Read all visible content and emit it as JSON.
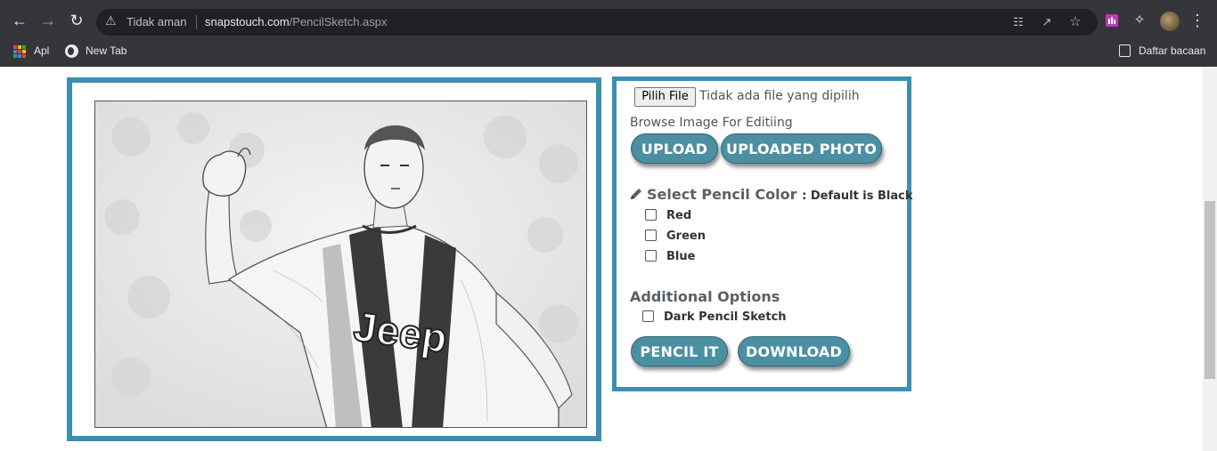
{
  "browser": {
    "security_label": "Tidak aman",
    "url_host": "snapstouch.com",
    "url_path": "/PencilSketch.aspx",
    "bookmarks": [
      {
        "label": "Apl"
      },
      {
        "label": "New Tab"
      }
    ],
    "reading_list_label": "Daftar bacaan"
  },
  "upload": {
    "file_button_label": "Pilih File",
    "file_status": "Tidak ada file yang dipilih",
    "browse_label": "Browse Image For Editiing",
    "upload_label": "UPLOAD",
    "uploaded_photo_label": "UPLOADED PHOTO"
  },
  "pencil_color": {
    "title": "Select Pencil Color",
    "subtitle": ": Default is Black",
    "options": [
      {
        "label": "Red",
        "checked": false
      },
      {
        "label": "Green",
        "checked": false
      },
      {
        "label": "Blue",
        "checked": false
      }
    ]
  },
  "additional": {
    "title": "Additional Options",
    "dark_sketch_label": "Dark Pencil Sketch",
    "dark_sketch_checked": false
  },
  "actions": {
    "pencil_it_label": "PENCIL IT",
    "download_label": "DOWNLOAD"
  },
  "sketch_image": {
    "jersey_text": "Jeep"
  },
  "colors": {
    "accent_border": "#3d8fb0",
    "button_fill": "#4b8fa3"
  }
}
